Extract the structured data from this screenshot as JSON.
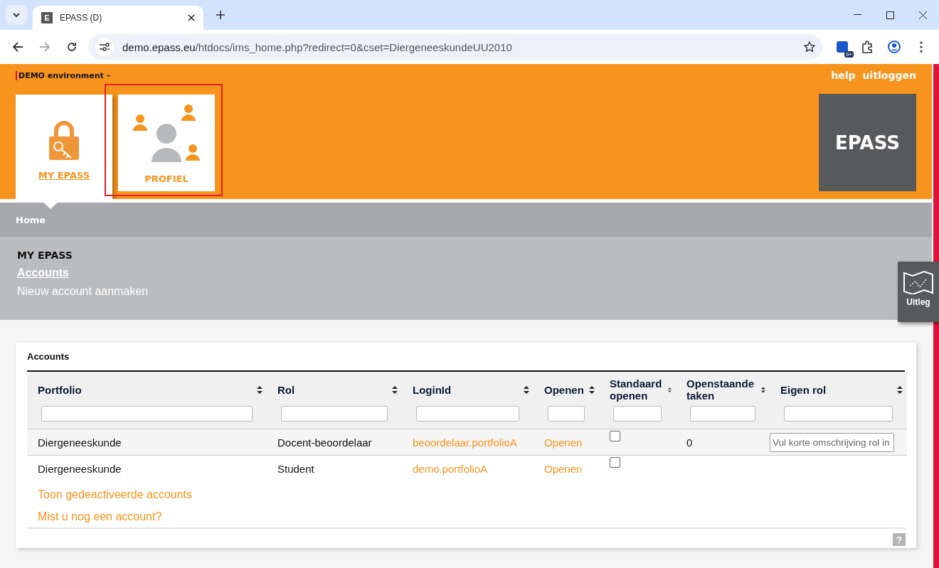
{
  "browser": {
    "tabs": [
      {
        "favicon": "E",
        "title": "EPASS (D)",
        "selected": true
      }
    ],
    "url_host": "demo.epass.eu",
    "url_path": "/htdocs/ims_home.php?redirect=0&cset=DiergeneeskundeUU2010",
    "extension_badge": "9+"
  },
  "header": {
    "environment": "DEMO environment –",
    "links": [
      "help",
      "uitloggen"
    ],
    "tiles": [
      {
        "label": "MY EPASS",
        "kind": "lock",
        "selected": true,
        "highlighted": false
      },
      {
        "label": "PROFIEL",
        "kind": "people",
        "selected": false,
        "highlighted": true
      }
    ],
    "logo": "EPASS"
  },
  "breadcrumb": "Home",
  "section": {
    "title": "MY EPASS",
    "links": [
      {
        "label": "Accounts",
        "selected": true
      },
      {
        "label": "Nieuw account aanmaken",
        "selected": false
      }
    ]
  },
  "side_button": "Uitleg",
  "card": {
    "title": "Accounts",
    "columns": [
      "Portfolio",
      "Rol",
      "LoginId",
      "Openen",
      "Standaard openen",
      "Openstaande taken",
      "Eigen rol"
    ],
    "rows": [
      {
        "portfolio": "Diergeneeskunde",
        "rol": "Docent-beoordelaar",
        "login_id": "beoordelaar.portfolioA",
        "openen": "Openen",
        "standaard_openen": false,
        "openstaande_taken": "0",
        "eigen_rol_placeholder": "Vul korte omschrijving rol in"
      },
      {
        "portfolio": "Diergeneeskunde",
        "rol": "Student",
        "login_id": "demo.portfolioA",
        "openen": "Openen",
        "standaard_openen": false
      }
    ],
    "footer_links": [
      "Toon gedeactiveerde accounts",
      "Mist u nog een account?"
    ],
    "help": "?"
  }
}
